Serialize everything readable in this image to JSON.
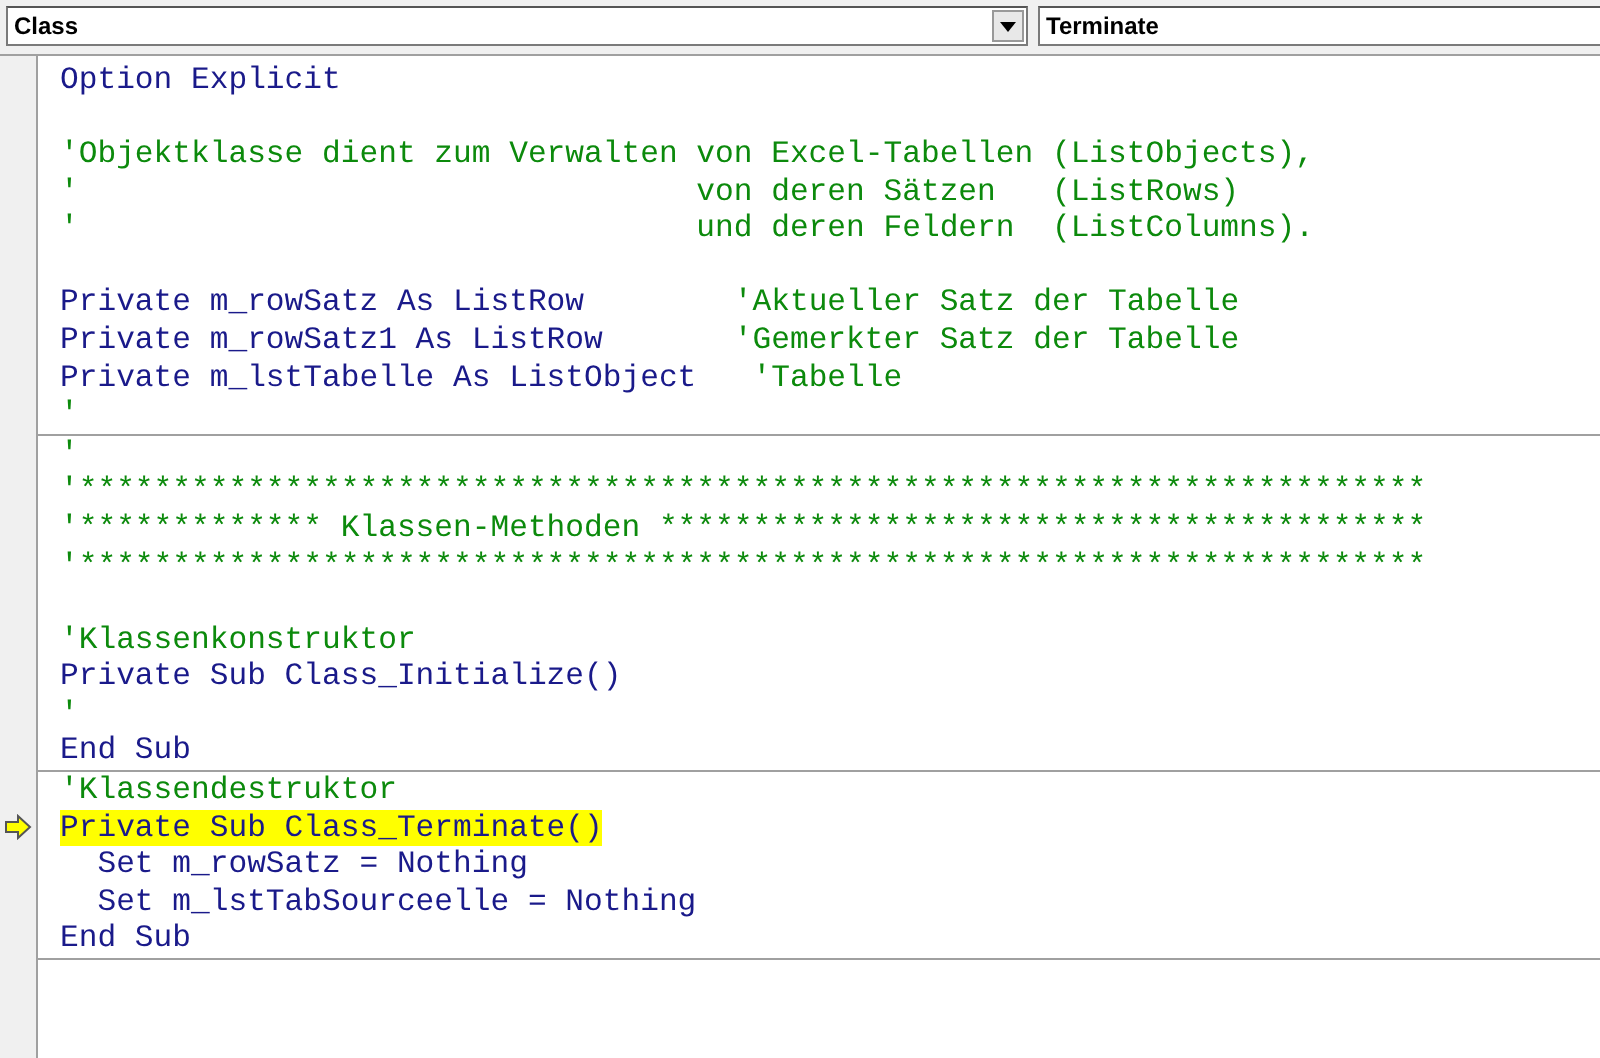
{
  "object_dropdown": {
    "value": "Class"
  },
  "procedure_dropdown": {
    "value": "Terminate"
  },
  "code": {
    "sections": [
      {
        "blocks": [
          {
            "lines": [
              {
                "current": false,
                "segments": [
                  {
                    "kind": "code",
                    "text": "Option Explicit"
                  }
                ]
              }
            ]
          },
          {
            "lines": [
              {
                "current": false,
                "segments": [
                  {
                    "kind": "comment",
                    "text": "'Objektklasse dient zum Verwalten von Excel-Tabellen (ListObjects),"
                  }
                ]
              },
              {
                "current": false,
                "segments": [
                  {
                    "kind": "comment",
                    "text": "'                                 von deren Sätzen   (ListRows)"
                  }
                ]
              },
              {
                "current": false,
                "segments": [
                  {
                    "kind": "comment",
                    "text": "'                                 und deren Feldern  (ListColumns)."
                  }
                ]
              }
            ]
          },
          {
            "lines": [
              {
                "current": false,
                "segments": [
                  {
                    "kind": "code",
                    "text": "Private m_rowSatz As ListRow        "
                  },
                  {
                    "kind": "comment",
                    "text": "'Aktueller Satz der Tabelle"
                  }
                ]
              },
              {
                "current": false,
                "segments": [
                  {
                    "kind": "code",
                    "text": "Private m_rowSatz1 As ListRow       "
                  },
                  {
                    "kind": "comment",
                    "text": "'Gemerkter Satz der Tabelle"
                  }
                ]
              },
              {
                "current": false,
                "segments": [
                  {
                    "kind": "code",
                    "text": "Private m_lstTabelle As ListObject   "
                  },
                  {
                    "kind": "comment",
                    "text": "'Tabelle"
                  }
                ]
              },
              {
                "current": false,
                "segments": [
                  {
                    "kind": "comment",
                    "text": "'"
                  }
                ]
              }
            ]
          }
        ]
      },
      {
        "blocks": [
          {
            "lines": [
              {
                "current": false,
                "segments": [
                  {
                    "kind": "comment",
                    "text": "'"
                  }
                ]
              },
              {
                "current": false,
                "segments": [
                  {
                    "kind": "comment",
                    "text": "'************************************************************************"
                  }
                ]
              },
              {
                "current": false,
                "segments": [
                  {
                    "kind": "comment",
                    "text": "'************* Klassen-Methoden *****************************************"
                  }
                ]
              },
              {
                "current": false,
                "segments": [
                  {
                    "kind": "comment",
                    "text": "'************************************************************************"
                  }
                ]
              }
            ]
          },
          {
            "lines": [
              {
                "current": false,
                "segments": [
                  {
                    "kind": "comment",
                    "text": "'Klassenkonstruktor"
                  }
                ]
              },
              {
                "current": false,
                "segments": [
                  {
                    "kind": "code",
                    "text": "Private Sub Class_Initialize()"
                  }
                ]
              },
              {
                "current": false,
                "segments": [
                  {
                    "kind": "comment",
                    "text": "'"
                  }
                ]
              },
              {
                "current": false,
                "segments": [
                  {
                    "kind": "code",
                    "text": "End Sub"
                  }
                ]
              }
            ]
          }
        ]
      },
      {
        "blocks": [
          {
            "lines": [
              {
                "current": false,
                "segments": [
                  {
                    "kind": "comment",
                    "text": "'Klassendestruktor"
                  }
                ]
              },
              {
                "current": true,
                "segments": [
                  {
                    "kind": "code",
                    "text": "Private Sub Class_Terminate()"
                  }
                ]
              },
              {
                "current": false,
                "segments": [
                  {
                    "kind": "code",
                    "text": "  Set m_rowSatz = Nothing"
                  }
                ]
              },
              {
                "current": false,
                "segments": [
                  {
                    "kind": "code",
                    "text": "  Set m_lstTabSourceelle = Nothing"
                  }
                ]
              },
              {
                "current": false,
                "segments": [
                  {
                    "kind": "code",
                    "text": "End Sub"
                  }
                ]
              }
            ]
          }
        ]
      }
    ]
  }
}
